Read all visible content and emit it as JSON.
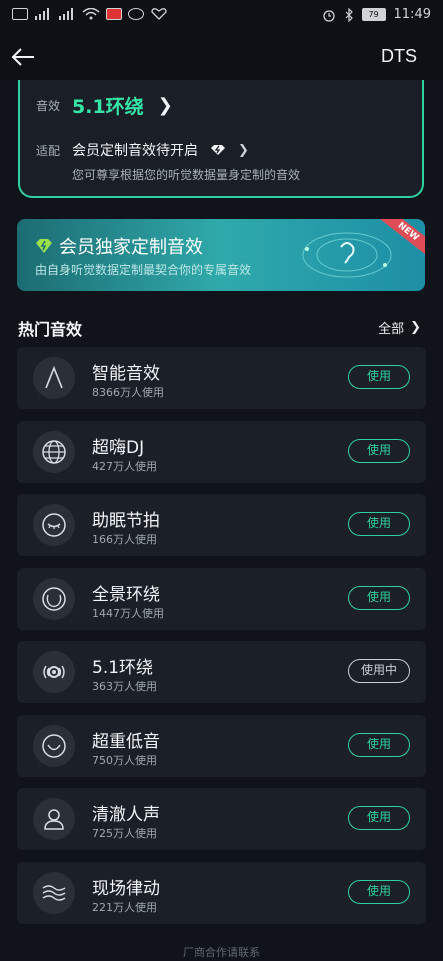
{
  "status_bar": {
    "time": "11:49",
    "battery": "79"
  },
  "header": {
    "title": "DTS"
  },
  "effect_card": {
    "effect_label": "音效",
    "effect_value": "5.1环绕",
    "adapt_label": "适配",
    "adapt_value": "会员定制音效待开启",
    "adapt_sub": "您可尊享根据您的听觉数据量身定制的音效"
  },
  "banner": {
    "title": "会员独家定制音效",
    "subtitle": "由自身听觉数据定制最契合你的专属音效",
    "badge": "NEW"
  },
  "section": {
    "title": "热门音效",
    "all_label": "全部"
  },
  "effects": [
    {
      "name": "智能音效",
      "usage": "8366万人使用",
      "button": "使用",
      "icon": "letter-a-icon"
    },
    {
      "name": "超嗨DJ",
      "usage": "427万人使用",
      "button": "使用",
      "icon": "globe-icon"
    },
    {
      "name": "助眠节拍",
      "usage": "166万人使用",
      "button": "使用",
      "icon": "sleep-eye-icon"
    },
    {
      "name": "全景环绕",
      "usage": "1447万人使用",
      "button": "使用",
      "icon": "surround-icon"
    },
    {
      "name": "5.1环绕",
      "usage": "363万人使用",
      "button": "使用中",
      "icon": "speaker-icon"
    },
    {
      "name": "超重低音",
      "usage": "750万人使用",
      "button": "使用",
      "icon": "bass-icon"
    },
    {
      "name": "清澈人声",
      "usage": "725万人使用",
      "button": "使用",
      "icon": "person-icon"
    },
    {
      "name": "现场律动",
      "usage": "221万人使用",
      "button": "使用",
      "icon": "wave-icon"
    }
  ],
  "footer": {
    "text": "厂商合作请联系"
  },
  "colors": {
    "accent": "#2fd09d",
    "background": "#10141a",
    "card": "#1b1f27"
  }
}
